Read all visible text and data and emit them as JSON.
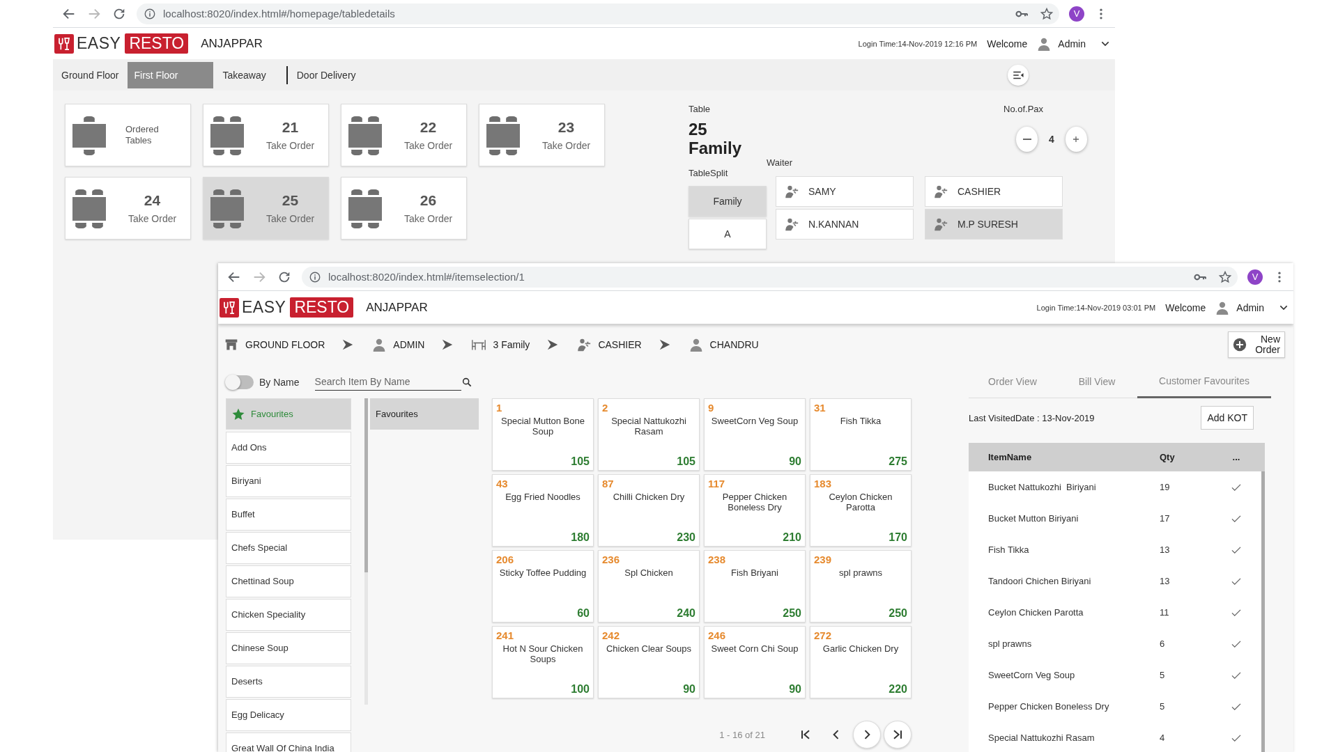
{
  "table_window": {
    "browser": {
      "url": "localhost:8020/index.html#/homepage/tabledetails",
      "profile": "V"
    },
    "header": {
      "logo_left": "EASY",
      "logo_right": "RESTO",
      "restaurant": "ANJAPPAR",
      "login": "Login Time:14-Nov-2019 12:16 PM",
      "welcome": "Welcome",
      "user": "Admin"
    },
    "floor_tabs": [
      {
        "label": "Ground Floor",
        "selected": false
      },
      {
        "label": "First Floor",
        "selected": true
      },
      {
        "label": "Takeaway",
        "selected": false
      },
      {
        "label": "Door Delivery",
        "selected": false
      }
    ],
    "tables": [
      {
        "kind": "legend",
        "label": "Ordered Tables"
      },
      {
        "kind": "table",
        "number": "21",
        "label": "Take Order",
        "selected": false
      },
      {
        "kind": "table",
        "number": "22",
        "label": "Take Order",
        "selected": false
      },
      {
        "kind": "table",
        "number": "23",
        "label": "Take Order",
        "selected": false
      },
      {
        "kind": "table",
        "number": "24",
        "label": "Take Order",
        "selected": false
      },
      {
        "kind": "table",
        "number": "25",
        "label": "Take Order",
        "selected": true
      },
      {
        "kind": "table",
        "number": "26",
        "label": "Take Order",
        "selected": false
      }
    ],
    "table_info": {
      "label": "Table",
      "name": "25 Family",
      "pax_label": "No.of.Pax",
      "pax": "4",
      "split_label": "TableSplit",
      "splits": [
        {
          "label": "Family",
          "selected": true
        },
        {
          "label": "A",
          "selected": false
        }
      ],
      "waiter_label": "Waiter",
      "waiters": [
        {
          "name": "SAMY",
          "selected": false
        },
        {
          "name": "CASHIER",
          "selected": false
        },
        {
          "name": "N.KANNAN",
          "selected": false
        },
        {
          "name": "M.P SURESH",
          "selected": true
        }
      ]
    }
  },
  "item_window": {
    "browser": {
      "url": "localhost:8020/index.html#/itemselection/1",
      "profile": "V"
    },
    "header": {
      "logo_left": "EASY",
      "logo_right": "RESTO",
      "restaurant": "ANJAPPAR",
      "login": "Login Time:14-Nov-2019 03:01 PM",
      "welcome": "Welcome",
      "user": "Admin"
    },
    "breadcrumb": [
      {
        "kind": "floor",
        "label": "GROUND FLOOR"
      },
      {
        "kind": "user",
        "label": "ADMIN"
      },
      {
        "kind": "table",
        "label": "3 Family"
      },
      {
        "kind": "waiter",
        "label": "CASHIER"
      },
      {
        "kind": "customer",
        "label": "CHANDRU"
      }
    ],
    "new_order": "New Order",
    "toggle": {
      "label": "By Name",
      "on": false
    },
    "search": {
      "placeholder": "Search Item By Name"
    },
    "categories": [
      {
        "kind": "favourite",
        "label": "Favourites",
        "selected": true
      },
      {
        "kind": "category",
        "label": "Add Ons",
        "selected": false
      },
      {
        "kind": "category",
        "label": "Biriyani",
        "selected": false
      },
      {
        "kind": "category",
        "label": "Buffet",
        "selected": false
      },
      {
        "kind": "category",
        "label": "Chefs Special",
        "selected": false
      },
      {
        "kind": "category",
        "label": "Chettinad Soup",
        "selected": false
      },
      {
        "kind": "category",
        "label": "Chicken Speciality",
        "selected": false
      },
      {
        "kind": "category",
        "label": "Chinese Soup",
        "selected": false
      },
      {
        "kind": "category",
        "label": "Deserts",
        "selected": false
      },
      {
        "kind": "category",
        "label": "Egg Delicacy",
        "selected": false
      },
      {
        "kind": "category",
        "label": "Great Wall Of China India",
        "selected": false
      }
    ],
    "subcategories": [
      {
        "label": "Favourites",
        "selected": true
      }
    ],
    "items": [
      {
        "code": "1",
        "name": "Special Mutton Bone Soup",
        "price": "105"
      },
      {
        "code": "2",
        "name": "Special Nattukozhi Rasam",
        "price": "105"
      },
      {
        "code": "9",
        "name": "SweetCorn Veg Soup",
        "price": "90"
      },
      {
        "code": "31",
        "name": "Fish Tikka",
        "price": "275"
      },
      {
        "code": "43",
        "name": "Egg Fried Noodles",
        "price": "180"
      },
      {
        "code": "87",
        "name": "Chilli Chicken Dry",
        "price": "230"
      },
      {
        "code": "117",
        "name": "Pepper Chicken Boneless Dry",
        "price": "210"
      },
      {
        "code": "183",
        "name": "Ceylon Chicken Parotta",
        "price": "170"
      },
      {
        "code": "206",
        "name": "Sticky Toffee Pudding",
        "price": "60"
      },
      {
        "code": "236",
        "name": "Spl Chicken",
        "price": "240"
      },
      {
        "code": "238",
        "name": "Fish Briyani",
        "price": "250"
      },
      {
        "code": "239",
        "name": "spl prawns",
        "price": "250"
      },
      {
        "code": "241",
        "name": "Hot N Sour Chicken Soups",
        "price": "100"
      },
      {
        "code": "242",
        "name": "Chicken Clear Soups",
        "price": "90"
      },
      {
        "code": "246",
        "name": "Sweet Corn Chi Soup",
        "price": "90"
      },
      {
        "code": "272",
        "name": "Garlic Chicken Dry",
        "price": "220"
      }
    ],
    "pagination": "1 - 16 of 21",
    "view_tabs": [
      {
        "label": "Order View",
        "selected": false
      },
      {
        "label": "Bill View",
        "selected": false
      },
      {
        "label": "Customer Favourites",
        "selected": true
      }
    ],
    "last_visited": "Last VisitedDate : 13-Nov-2019",
    "add_kot": "Add KOT",
    "favourites": {
      "columns": [
        "ItemName",
        "Qty",
        "..."
      ],
      "rows": [
        {
          "name": "Bucket Nattukozhi  Biriyani",
          "qty": "19"
        },
        {
          "name": "Bucket Mutton Biriyani",
          "qty": "17"
        },
        {
          "name": "Fish Tikka",
          "qty": "13"
        },
        {
          "name": "Tandoori Chichen Biriyani",
          "qty": "13"
        },
        {
          "name": "Ceylon Chicken Parotta",
          "qty": "11"
        },
        {
          "name": "spl prawns",
          "qty": "6"
        },
        {
          "name": "SweetCorn Veg Soup",
          "qty": "5"
        },
        {
          "name": "Pepper Chicken Boneless Dry",
          "qty": "5"
        },
        {
          "name": "Special Nattukozhi Rasam",
          "qty": "4"
        }
      ]
    }
  }
}
